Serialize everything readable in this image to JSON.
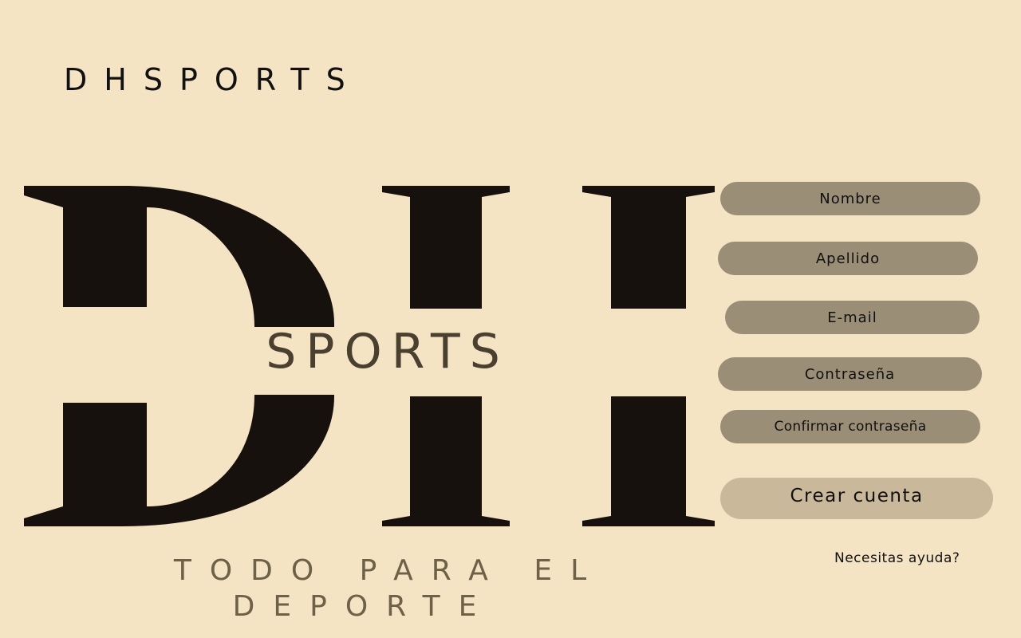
{
  "header": {
    "brand_title": "DHSPORTS"
  },
  "logo": {
    "letters": "DH",
    "wordmark": "SPORTS",
    "tagline_line1": "TODO PARA EL",
    "tagline_line2": "DEPORTE",
    "icon": "dhsports-logo-icon"
  },
  "form": {
    "fields": [
      {
        "placeholder": "Nombre"
      },
      {
        "placeholder": "Apellido"
      },
      {
        "placeholder": "E-mail"
      },
      {
        "placeholder": "Contraseña"
      },
      {
        "placeholder": "Confirmar contraseña"
      }
    ],
    "submit_label": "Crear cuenta",
    "help_label": "Necesitas ayuda?"
  },
  "colors": {
    "background": "#f5e4c4",
    "field_fill": "#9a8e77",
    "button_fill": "#c9b99a",
    "logo_dark": "#16110d",
    "logo_text": "#4a4030"
  }
}
